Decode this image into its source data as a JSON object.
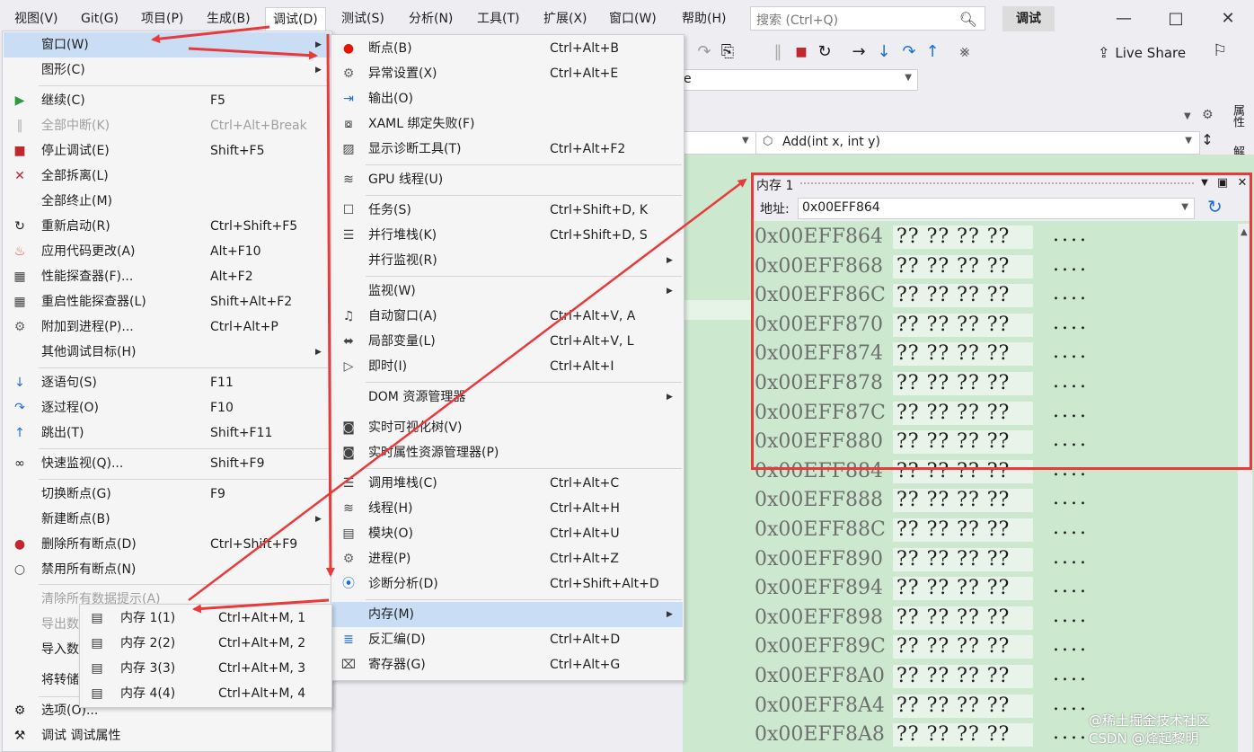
{
  "menubar": {
    "items": [
      "视图(V)",
      "Git(G)",
      "项目(P)",
      "生成(B)",
      "调试(D)",
      "测试(S)",
      "分析(N)",
      "工具(T)",
      "扩展(X)",
      "窗口(W)",
      "帮助(H)"
    ],
    "search_placeholder": "搜索 (Ctrl+Q)",
    "mode_badge": "调试"
  },
  "toolbar": {
    "live_share": "Live Share"
  },
  "combo1": {
    "value": "e"
  },
  "navbar": {
    "method": "Add(int x, int y)"
  },
  "side_tabs": [
    "属性",
    "解决"
  ],
  "debug_menu": [
    {
      "label": "窗口(W)",
      "shortcut": "",
      "icon": "",
      "submenu": true,
      "highlight": true
    },
    {
      "label": "图形(C)",
      "shortcut": "",
      "icon": "",
      "submenu": true
    },
    {
      "label": "继续(C)",
      "shortcut": "F5",
      "icon": "play-icon"
    },
    {
      "label": "全部中断(K)",
      "shortcut": "Ctrl+Alt+Break",
      "icon": "pause-icon",
      "disabled": true
    },
    {
      "label": "停止调试(E)",
      "shortcut": "Shift+F5",
      "icon": "stop-icon"
    },
    {
      "label": "全部拆离(L)",
      "shortcut": "",
      "icon": "detach-icon"
    },
    {
      "label": "全部终止(M)",
      "shortcut": "",
      "icon": ""
    },
    {
      "label": "重新启动(R)",
      "shortcut": "Ctrl+Shift+F5",
      "icon": "restart-icon"
    },
    {
      "label": "应用代码更改(A)",
      "shortcut": "Alt+F10",
      "icon": "hot-reload-icon"
    },
    {
      "label": "性能探查器(F)...",
      "shortcut": "Alt+F2",
      "icon": "profiler-icon"
    },
    {
      "label": "重启性能探查器(L)",
      "shortcut": "Shift+Alt+F2",
      "icon": "profiler-restart-icon"
    },
    {
      "label": "附加到进程(P)...",
      "shortcut": "Ctrl+Alt+P",
      "icon": "attach-icon"
    },
    {
      "label": "其他调试目标(H)",
      "shortcut": "",
      "icon": "",
      "submenu": true
    },
    {
      "label": "逐语句(S)",
      "shortcut": "F11",
      "icon": "step-into-icon"
    },
    {
      "label": "逐过程(O)",
      "shortcut": "F10",
      "icon": "step-over-icon"
    },
    {
      "label": "跳出(T)",
      "shortcut": "Shift+F11",
      "icon": "step-out-icon"
    },
    {
      "label": "快速监视(Q)...",
      "shortcut": "Shift+F9",
      "icon": "glasses-icon"
    },
    {
      "label": "切换断点(G)",
      "shortcut": "F9",
      "icon": ""
    },
    {
      "label": "新建断点(B)",
      "shortcut": "",
      "icon": "",
      "submenu": true
    },
    {
      "label": "删除所有断点(D)",
      "shortcut": "Ctrl+Shift+F9",
      "icon": "delete-breakpoints-icon"
    },
    {
      "label": "禁用所有断点(N)",
      "shortcut": "",
      "icon": "disable-breakpoints-icon"
    },
    {
      "label": "清除所有数据提示(A)",
      "shortcut": "",
      "icon": "",
      "disabled": true
    },
    {
      "label": "导出数",
      "shortcut": "",
      "icon": "",
      "disabled": true
    },
    {
      "label": "导入数",
      "shortcut": "",
      "icon": ""
    },
    {
      "label": "将转储",
      "shortcut": "",
      "icon": ""
    },
    {
      "label": "选项(O)...",
      "shortcut": "",
      "icon": "gear-icon"
    },
    {
      "label": "调试 调试属性",
      "shortcut": "",
      "icon": "wrench-icon"
    }
  ],
  "window_menu": [
    {
      "label": "断点(B)",
      "shortcut": "Ctrl+Alt+B",
      "icon": "breakpoint-icon"
    },
    {
      "label": "异常设置(X)",
      "shortcut": "Ctrl+Alt+E",
      "icon": "exception-icon"
    },
    {
      "label": "输出(O)",
      "shortcut": "",
      "icon": "output-icon"
    },
    {
      "label": "XAML 绑定失败(F)",
      "shortcut": "",
      "icon": "xaml-icon"
    },
    {
      "label": "显示诊断工具(T)",
      "shortcut": "Ctrl+Alt+F2",
      "icon": "diagnostics-icon"
    },
    {
      "label": "GPU 线程(U)",
      "shortcut": "",
      "icon": "gpu-thread-icon"
    },
    {
      "label": "任务(S)",
      "shortcut": "Ctrl+Shift+D, K",
      "icon": "task-icon"
    },
    {
      "label": "并行堆栈(K)",
      "shortcut": "Ctrl+Shift+D, S",
      "icon": "parallel-stack-icon"
    },
    {
      "label": "并行监视(R)",
      "shortcut": "",
      "icon": "",
      "submenu": true
    },
    {
      "label": "监视(W)",
      "shortcut": "",
      "icon": "",
      "submenu": true
    },
    {
      "label": "自动窗口(A)",
      "shortcut": "Ctrl+Alt+V, A",
      "icon": "autos-icon"
    },
    {
      "label": "局部变量(L)",
      "shortcut": "Ctrl+Alt+V, L",
      "icon": "locals-icon"
    },
    {
      "label": "即时(I)",
      "shortcut": "Ctrl+Alt+I",
      "icon": "immediate-icon"
    },
    {
      "label": "DOM 资源管理器",
      "shortcut": "",
      "icon": "",
      "submenu": true
    },
    {
      "label": "实时可视化树(V)",
      "shortcut": "",
      "icon": "camera-icon"
    },
    {
      "label": "实时属性资源管理器(P)",
      "shortcut": "",
      "icon": "camera-icon"
    },
    {
      "label": "调用堆栈(C)",
      "shortcut": "Ctrl+Alt+C",
      "icon": "call-stack-icon"
    },
    {
      "label": "线程(H)",
      "shortcut": "Ctrl+Alt+H",
      "icon": "thread-icon"
    },
    {
      "label": "模块(O)",
      "shortcut": "Ctrl+Alt+U",
      "icon": "module-icon"
    },
    {
      "label": "进程(P)",
      "shortcut": "Ctrl+Alt+Z",
      "icon": "process-icon"
    },
    {
      "label": "诊断分析(D)",
      "shortcut": "Ctrl+Shift+Alt+D",
      "icon": "diagnostic-analysis-icon"
    },
    {
      "label": "内存(M)",
      "shortcut": "",
      "icon": "",
      "submenu": true,
      "highlight": true
    },
    {
      "label": "反汇编(D)",
      "shortcut": "Ctrl+Alt+D",
      "icon": "disassembly-icon"
    },
    {
      "label": "寄存器(G)",
      "shortcut": "Ctrl+Alt+G",
      "icon": "registers-icon"
    }
  ],
  "memory_menu": [
    {
      "label": "内存 1(1)",
      "shortcut": "Ctrl+Alt+M, 1"
    },
    {
      "label": "内存 2(2)",
      "shortcut": "Ctrl+Alt+M, 2"
    },
    {
      "label": "内存 3(3)",
      "shortcut": "Ctrl+Alt+M, 3"
    },
    {
      "label": "内存 4(4)",
      "shortcut": "Ctrl+Alt+M, 4"
    }
  ],
  "memory_window": {
    "title": "内存 1",
    "address_label": "地址:",
    "address_value": "0x00EFF864",
    "rows": [
      {
        "addr": "0x00EFF864",
        "bytes": "?? ?? ?? ??",
        "ascii": "...."
      },
      {
        "addr": "0x00EFF868",
        "bytes": "?? ?? ?? ??",
        "ascii": "...."
      },
      {
        "addr": "0x00EFF86C",
        "bytes": "?? ?? ?? ??",
        "ascii": "...."
      },
      {
        "addr": "0x00EFF870",
        "bytes": "?? ?? ?? ??",
        "ascii": "...."
      },
      {
        "addr": "0x00EFF874",
        "bytes": "?? ?? ?? ??",
        "ascii": "...."
      },
      {
        "addr": "0x00EFF878",
        "bytes": "?? ?? ?? ??",
        "ascii": "...."
      },
      {
        "addr": "0x00EFF87C",
        "bytes": "?? ?? ?? ??",
        "ascii": "...."
      },
      {
        "addr": "0x00EFF880",
        "bytes": "?? ?? ?? ??",
        "ascii": "...."
      },
      {
        "addr": "0x00EFF884",
        "bytes": "?? ?? ?? ??",
        "ascii": "...."
      },
      {
        "addr": "0x00EFF888",
        "bytes": "?? ?? ?? ??",
        "ascii": "...."
      },
      {
        "addr": "0x00EFF88C",
        "bytes": "?? ?? ?? ??",
        "ascii": "...."
      },
      {
        "addr": "0x00EFF890",
        "bytes": "?? ?? ?? ??",
        "ascii": "...."
      },
      {
        "addr": "0x00EFF894",
        "bytes": "?? ?? ?? ??",
        "ascii": "...."
      },
      {
        "addr": "0x00EFF898",
        "bytes": "?? ?? ?? ??",
        "ascii": "...."
      },
      {
        "addr": "0x00EFF89C",
        "bytes": "?? ?? ?? ??",
        "ascii": "...."
      },
      {
        "addr": "0x00EFF8A0",
        "bytes": "?? ?? ?? ??",
        "ascii": "...."
      },
      {
        "addr": "0x00EFF8A4",
        "bytes": "?? ?? ?? ??",
        "ascii": "...."
      },
      {
        "addr": "0x00EFF8A8",
        "bytes": "?? ?? ?? ??",
        "ascii": "...."
      }
    ]
  },
  "watermark": [
    "@稀土掘金技术社区",
    "CSDN @烽起黎明"
  ],
  "colors": {
    "annotation_red": "#e83a3a",
    "menu_highlight": "#c9def5",
    "editor_bg": "#cce8cf"
  }
}
